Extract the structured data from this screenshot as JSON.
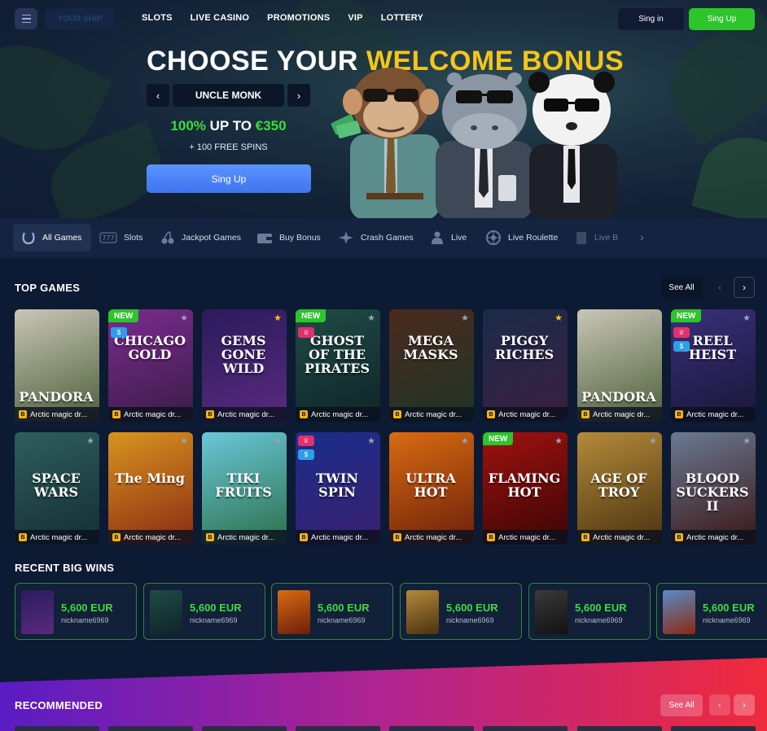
{
  "header": {
    "logo_text": "YOUR SHIP",
    "nav": [
      "SLOTS",
      "LIVE CASINO",
      "PROMOTIONS",
      "VIP",
      "LOTTERY"
    ],
    "signin_label": "Sing in",
    "signup_label": "Sing Up"
  },
  "hero": {
    "title_white": "CHOOSE YOUR",
    "title_yellow": "WELCOME BONUS",
    "bonus_name": "UNCLE MONK",
    "amount_prefix": "100%",
    "amount_mid": "UP TO",
    "amount_value": "€350",
    "free_spins": "+ 100 FREE SPINS",
    "cta": "Sing Up",
    "characters": [
      "monkey-character",
      "hippo-character",
      "panda-character"
    ]
  },
  "categories": [
    {
      "label": "All Games",
      "icon": "horseshoe-icon",
      "active": true
    },
    {
      "label": "Slots",
      "icon": "slot-777-icon"
    },
    {
      "label": "Jackpot Games",
      "icon": "cherries-icon"
    },
    {
      "label": "Buy Bonus",
      "icon": "wallet-icon"
    },
    {
      "label": "Crash Games",
      "icon": "plane-icon"
    },
    {
      "label": "Live",
      "icon": "live-dealer-icon"
    },
    {
      "label": "Live Roulette",
      "icon": "roulette-icon"
    },
    {
      "label": "Live B",
      "icon": "cards-icon"
    }
  ],
  "top_games": {
    "title": "TOP GAMES",
    "see_all": "See All",
    "provider_badge": "B",
    "caption": "Arctic magic dr...",
    "games": [
      {
        "name": "PANDORA",
        "badges": [],
        "star": "grey",
        "bg": [
          "#c9c6b6",
          "#4c5e3a"
        ]
      },
      {
        "name": "CHICAGO GOLD",
        "badges": [
          "NEW",
          "dollar"
        ],
        "star": "grey",
        "bg": [
          "#7b2b8f",
          "#3a1c46"
        ]
      },
      {
        "name": "GEMS GONE WILD",
        "badges": [],
        "star": "gold",
        "bg": [
          "#2a1b5c",
          "#5a2a7f"
        ]
      },
      {
        "name": "GHOST OF THE PIRATES",
        "badges": [
          "NEW",
          "trophy"
        ],
        "star": "grey",
        "bg": [
          "#1f4b46",
          "#0f2426"
        ]
      },
      {
        "name": "MEGA MASKS",
        "badges": [],
        "star": "grey",
        "bg": [
          "#4b2a1e",
          "#1e3527"
        ]
      },
      {
        "name": "PIGGY RICHES",
        "badges": [],
        "star": "gold",
        "bg": [
          "#1b2a4a",
          "#3b1f3f"
        ]
      },
      {
        "name": "PANDORA",
        "badges": [],
        "star": "grey",
        "bg": [
          "#c9c6b6",
          "#4c5e3a"
        ]
      },
      {
        "name": "REEL HEIST",
        "badges": [
          "NEW",
          "trophy",
          "dollar"
        ],
        "star": "grey",
        "bg": [
          "#3a2f7a",
          "#1a1638"
        ]
      },
      {
        "name": "SPACE WARS",
        "badges": [],
        "star": "grey",
        "bg": [
          "#2e5e5d",
          "#142d34"
        ]
      },
      {
        "name": "The Ming",
        "badges": [],
        "star": "grey",
        "bg": [
          "#d8941f",
          "#8a2a12"
        ]
      },
      {
        "name": "TIKI FRUITS",
        "badges": [],
        "star": "grey",
        "bg": [
          "#69c7d8",
          "#2c6f4a"
        ]
      },
      {
        "name": "TWIN SPIN",
        "badges": [
          "trophy",
          "dollar"
        ],
        "star": "grey",
        "bg": [
          "#1a2e8c",
          "#3a1f6e"
        ]
      },
      {
        "name": "ULTRA HOT",
        "badges": [],
        "star": "grey",
        "bg": [
          "#d96b12",
          "#6b1f0a"
        ]
      },
      {
        "name": "FLAMING HOT",
        "badges": [
          "NEW"
        ],
        "star": "grey",
        "bg": [
          "#a0120f",
          "#3a0505"
        ]
      },
      {
        "name": "AGE OF TROY",
        "badges": [],
        "star": "grey",
        "bg": [
          "#b48a3a",
          "#4a3210"
        ]
      },
      {
        "name": "BLOOD SUCKERS II",
        "badges": [],
        "star": "grey",
        "bg": [
          "#6a7a92",
          "#3a1515"
        ]
      }
    ]
  },
  "recent_wins": {
    "title": "RECENT BIG WINS",
    "items": [
      {
        "amount": "5,600 EUR",
        "nickname": "nickname6969",
        "bg": [
          "#2a1b5c",
          "#5a2a7f"
        ]
      },
      {
        "amount": "5,600 EUR",
        "nickname": "nickname6969",
        "bg": [
          "#1f4b46",
          "#0f2426"
        ]
      },
      {
        "amount": "5,600 EUR",
        "nickname": "nickname6969",
        "bg": [
          "#d96b12",
          "#6b1f0a"
        ]
      },
      {
        "amount": "5,600 EUR",
        "nickname": "nickname6969",
        "bg": [
          "#b48a3a",
          "#4a3210"
        ]
      },
      {
        "amount": "5,600 EUR",
        "nickname": "nickname6969",
        "bg": [
          "#3a3a3a",
          "#111111"
        ]
      },
      {
        "amount": "5,600 EUR",
        "nickname": "nickname6969",
        "bg": [
          "#5a8ac8",
          "#8a2a12"
        ]
      }
    ]
  },
  "recommended": {
    "title": "RECOMMENDED",
    "see_all": "See All"
  },
  "colors": {
    "page_bg": "#0d1a33",
    "accent_green": "#2ec42c",
    "accent_yellow": "#f5c518",
    "accent_blue": "#4a82f8",
    "win_amount": "#3ddc3a"
  }
}
